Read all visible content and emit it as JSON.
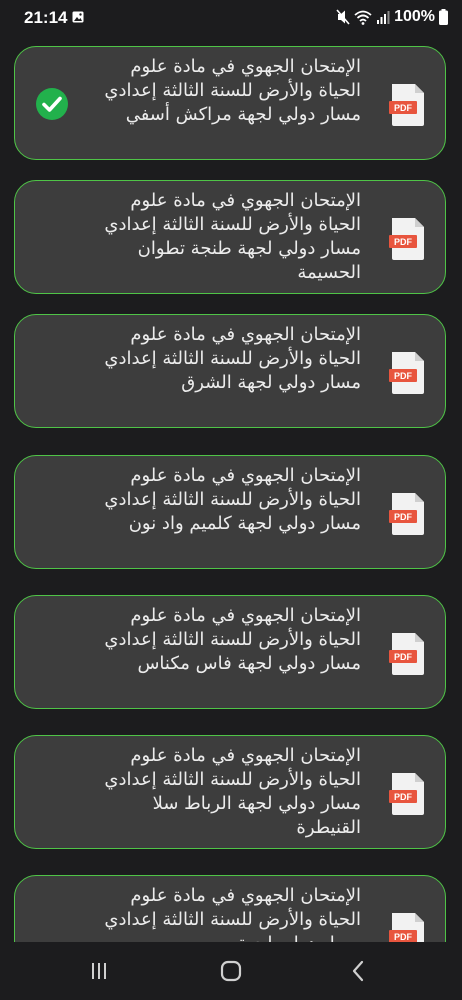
{
  "status_bar": {
    "time": "21:14",
    "battery": "100%"
  },
  "files": [
    {
      "title": "الإمتحان الجهوي في مادة علوم الحياة والأرض للسنة الثالثة إعدادي مسار دولي لجهة مراكش أسفي",
      "icon": "pdf-icon",
      "downloaded": true
    },
    {
      "title": "الإمتحان الجهوي في مادة علوم الحياة والأرض للسنة الثالثة إعدادي مسار دولي لجهة طنجة تطوان الحسيمة",
      "icon": "pdf-icon",
      "downloaded": false
    },
    {
      "title": "الإمتحان الجهوي في مادة علوم الحياة والأرض للسنة الثالثة إعدادي مسار دولي لجهة الشرق",
      "icon": "pdf-icon",
      "downloaded": false
    },
    {
      "title": "الإمتحان الجهوي في مادة علوم الحياة والأرض للسنة الثالثة إعدادي مسار دولي لجهة كلميم واد نون",
      "icon": "pdf-icon",
      "downloaded": false
    },
    {
      "title": "الإمتحان الجهوي في مادة علوم الحياة والأرض للسنة الثالثة إعدادي مسار دولي لجهة فاس مكناس",
      "icon": "pdf-icon",
      "downloaded": false
    },
    {
      "title": "الإمتحان الجهوي في مادة علوم الحياة والأرض للسنة الثالثة إعدادي مسار دولي لجهة الرباط سلا القنيطرة",
      "icon": "pdf-icon",
      "downloaded": false
    },
    {
      "title": "الإمتحان الجهوي في مادة علوم الحياة والأرض للسنة الثالثة إعدادي مسار دولي لجهة",
      "icon": "pdf-icon",
      "downloaded": false
    }
  ],
  "pdf_label": "PDF",
  "colors": {
    "background": "#1c1c1e",
    "card_background": "#3d3d3d",
    "card_border": "#4fc447",
    "check_green": "#22b14c",
    "pdf_red": "#e8553e"
  },
  "nav": {
    "recents": "recents-icon",
    "home": "home-icon",
    "back": "back-icon"
  }
}
